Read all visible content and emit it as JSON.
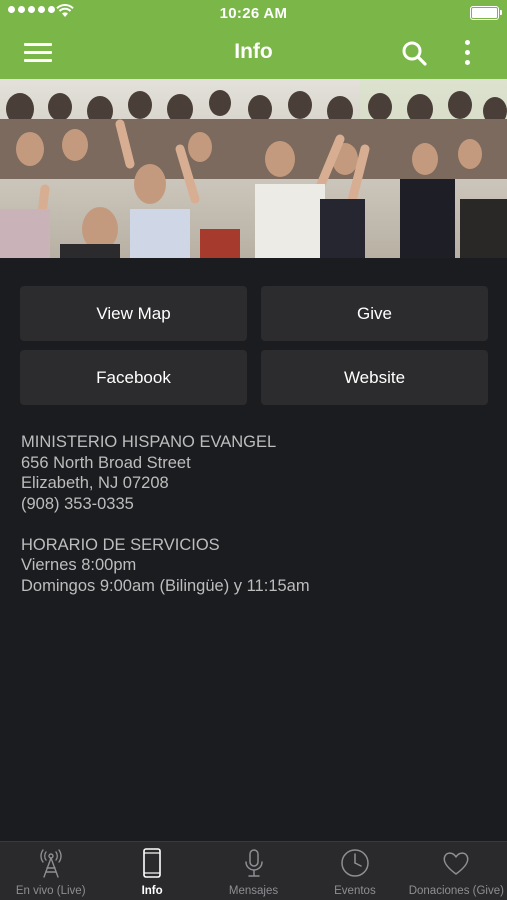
{
  "status_bar": {
    "time": "10:26 AM",
    "signal_icon": "signal-dots-icon",
    "wifi_icon": "wifi-icon",
    "battery_icon": "battery-icon"
  },
  "nav": {
    "title": "Info",
    "menu_icon": "hamburger-menu-icon",
    "search_icon": "search-icon",
    "more_icon": "more-vertical-icon",
    "background": "#7ab648"
  },
  "hero": {
    "image": "congregation-worship-photo"
  },
  "buttons": {
    "view_map": "View Map",
    "give": "Give",
    "facebook": "Facebook",
    "website": "Website"
  },
  "info": {
    "name": "MINISTERIO HISPANO EVANGEL",
    "street": "656 North Broad Street",
    "city": "Elizabeth, NJ 07208",
    "phone": "(908) 353-0335",
    "schedule_title": "HORARIO DE SERVICIOS",
    "schedule_friday": "Viernes 8:00pm",
    "schedule_sunday": "Domingos 9:00am (Bilingüe) y 11:15am"
  },
  "tabs": [
    {
      "label": "En vivo (Live)",
      "icon": "broadcast-tower-icon",
      "active": false
    },
    {
      "label": "Info",
      "icon": "phone-device-icon",
      "active": true
    },
    {
      "label": "Mensajes",
      "icon": "microphone-icon",
      "active": false
    },
    {
      "label": "Eventos",
      "icon": "clock-icon",
      "active": false
    },
    {
      "label": "Donaciones (Give)",
      "icon": "heart-icon",
      "active": false
    }
  ],
  "colors": {
    "accent": "#7ab648",
    "background": "#1b1c1f",
    "button": "#2c2c2e",
    "tab_bar": "#2a2a2c"
  }
}
